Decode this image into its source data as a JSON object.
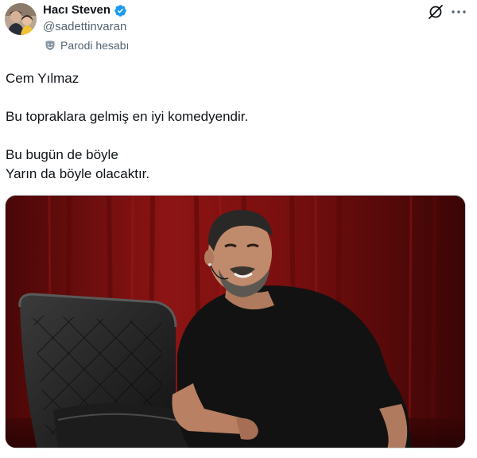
{
  "author": {
    "display_name": "Hacı Steven",
    "handle": "@sadettinvaran",
    "verified": true,
    "account_label": "Parodi hesabı"
  },
  "icons": {
    "verified": "verified-badge-icon",
    "parody": "parody-mask-icon",
    "grok": "grok-icon",
    "more": "more-options-icon"
  },
  "tweet": {
    "lines": [
      "Cem Yılmaz",
      "Bu topraklara gelmiş en iyi komedyendir.",
      "Bu bugün de böyle",
      "Yarın da böyle olacaktır."
    ]
  },
  "media": {
    "type": "photo"
  },
  "colors": {
    "verified_blue": "#1d9bf0",
    "secondary_text": "#536471",
    "primary_text": "#0f1419",
    "curtain_red": "#7a0f0f"
  }
}
